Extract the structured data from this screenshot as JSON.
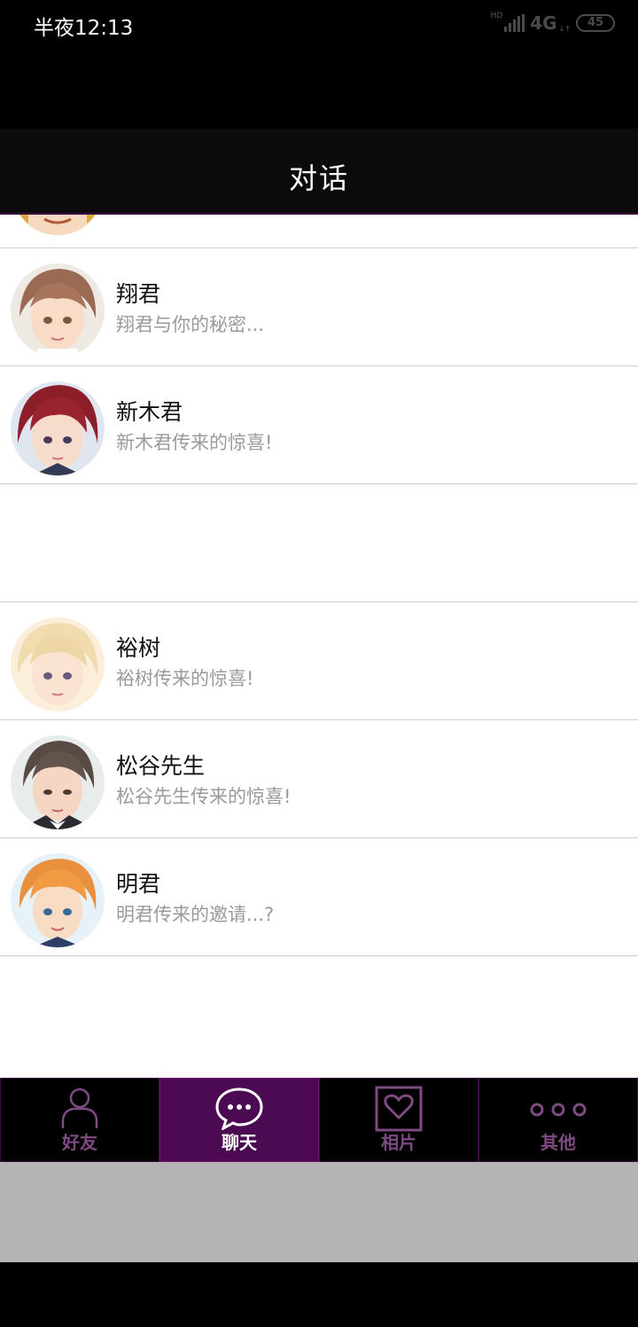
{
  "status_bar": {
    "time": "半夜12:13",
    "network": "4G",
    "battery": "45"
  },
  "header": {
    "title": "对话"
  },
  "chats": [
    {
      "name": "",
      "preview": ""
    },
    {
      "name": "翔君",
      "preview": "翔君与你的秘密..."
    },
    {
      "name": "新木君",
      "preview": "新木君传来的惊喜!"
    },
    {
      "name": "",
      "preview": ""
    },
    {
      "name": "裕树",
      "preview": "裕树传来的惊喜!"
    },
    {
      "name": "松谷先生",
      "preview": "松谷先生传来的惊喜!"
    },
    {
      "name": "明君",
      "preview": "明君传来的邀请...?"
    }
  ],
  "tabs": [
    {
      "label": "好友",
      "icon": "person-icon"
    },
    {
      "label": "聊天",
      "icon": "chat-bubble-icon",
      "active": true
    },
    {
      "label": "相片",
      "icon": "heart-photo-icon"
    },
    {
      "label": "其他",
      "icon": "more-dots-icon"
    }
  ],
  "colors": {
    "accent": "#4b0a52",
    "header_bg": "#0d0a0e",
    "preview_text": "#9a9a9a"
  }
}
